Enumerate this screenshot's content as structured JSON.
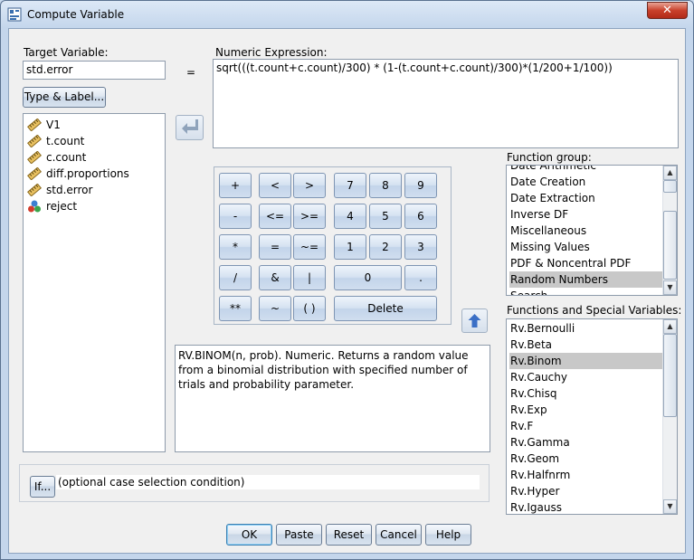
{
  "window": {
    "title": "Compute Variable",
    "close_glyph": "✕"
  },
  "target": {
    "label": "Target Variable:",
    "value": "std.error",
    "type_label_button": "Type & Label..."
  },
  "equals": "=",
  "expression": {
    "label": "Numeric Expression:",
    "value": "sqrt(((t.count+c.count)/300) * (1-(t.count+c.count)/300)*(1/200+1/100))"
  },
  "variables": [
    {
      "name": "V1",
      "icon": "ruler-icon"
    },
    {
      "name": "t.count",
      "icon": "ruler-icon"
    },
    {
      "name": "c.count",
      "icon": "ruler-icon"
    },
    {
      "name": "diff.proportions",
      "icon": "ruler-icon"
    },
    {
      "name": "std.error",
      "icon": "ruler-icon"
    },
    {
      "name": "reject",
      "icon": "nominal-icon"
    }
  ],
  "keypad": {
    "plus": "+",
    "lt": "<",
    "gt": ">",
    "k7": "7",
    "k8": "8",
    "k9": "9",
    "minus": "-",
    "le": "<=",
    "ge": ">=",
    "k4": "4",
    "k5": "5",
    "k6": "6",
    "mult": "*",
    "eq": "=",
    "ne": "~=",
    "k1": "1",
    "k2": "2",
    "k3": "3",
    "div": "/",
    "and": "&",
    "or": "|",
    "k0": "0",
    "dot": ".",
    "pow": "**",
    "not": "~",
    "paren": "( )",
    "delete": "Delete"
  },
  "description": "RV.BINOM(n, prob). Numeric. Returns a random value from a binomial distribution with specified number of trials and probability parameter.",
  "function_group": {
    "label": "Function group:",
    "items": [
      "Date Arithmetic",
      "Date Creation",
      "Date Extraction",
      "Inverse DF",
      "Miscellaneous",
      "Missing Values",
      "PDF & Noncentral PDF",
      "Random Numbers",
      "Search"
    ],
    "selected": "Random Numbers"
  },
  "functions": {
    "label": "Functions and Special Variables:",
    "items": [
      "Rv.Bernoulli",
      "Rv.Beta",
      "Rv.Binom",
      "Rv.Cauchy",
      "Rv.Chisq",
      "Rv.Exp",
      "Rv.F",
      "Rv.Gamma",
      "Rv.Geom",
      "Rv.Halfnrm",
      "Rv.Hyper",
      "Rv.Igauss"
    ],
    "selected": "Rv.Binom"
  },
  "if": {
    "button": "If...",
    "condition": "(optional case selection condition)"
  },
  "buttons": {
    "ok": "OK",
    "paste": "Paste",
    "reset": "Reset",
    "cancel": "Cancel",
    "help": "Help"
  }
}
